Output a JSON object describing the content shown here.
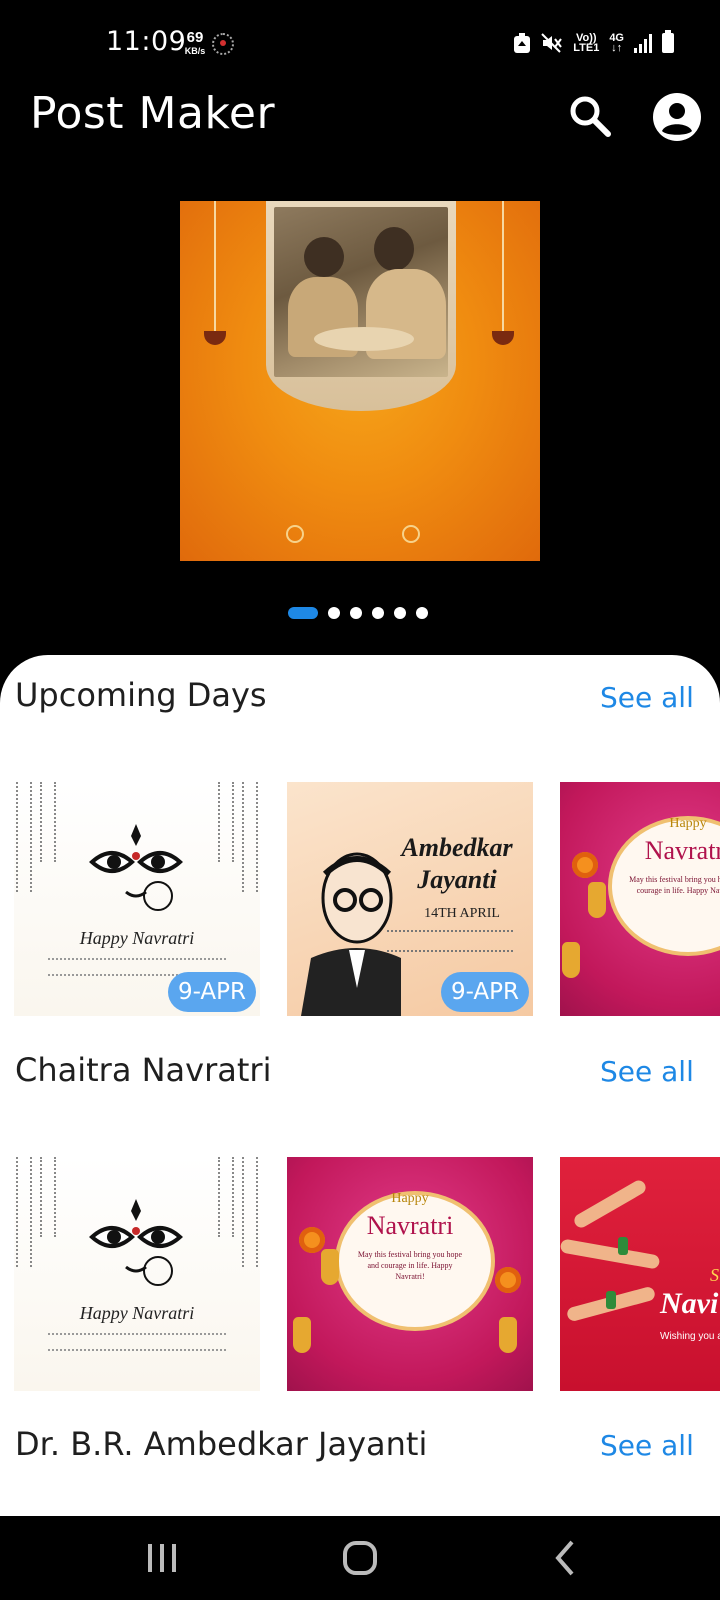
{
  "status_bar": {
    "time": "11:09",
    "speed_value": "69",
    "speed_unit": "KB/s",
    "network_label_top": "Vo))",
    "network_label_bottom": "LTE1",
    "network_type": "4G"
  },
  "app_bar": {
    "title": "Post Maker",
    "search_icon": "search-icon",
    "profile_icon": "account-circle-icon"
  },
  "carousel": {
    "page_count": 6,
    "active_index": 0
  },
  "sections": [
    {
      "title": "Upcoming Days",
      "see_all": "See all",
      "cards": [
        {
          "caption": "Happy Navratri",
          "badge": "9-APR"
        },
        {
          "title_line1": "Ambedkar",
          "title_line2": "Jayanti",
          "date": "14TH APRIL",
          "badge": "9-APR"
        },
        {
          "happy": "Happy",
          "title": "Navratri",
          "sub": "May this festival bring you hope and courage in life. Happy Navratri!"
        }
      ]
    },
    {
      "title": "Chaitra Navratri",
      "see_all": "See all",
      "cards": [
        {
          "caption": "Happy Navratri"
        },
        {
          "happy": "Happy",
          "title": "Navratri",
          "sub": "May this festival bring you hope and courage in life. Happy Navratri!"
        },
        {
          "title_small": "Su",
          "title": "Navi",
          "sub": "Wishing you a N faith, love, and l"
        }
      ]
    },
    {
      "title": "Dr. B.R. Ambedkar Jayanti",
      "see_all": "See all"
    }
  ],
  "nav_bar": {
    "recent_icon": "recent-apps-icon",
    "home_icon": "home-icon",
    "back_icon": "back-icon"
  },
  "colors": {
    "accent": "#1e88e5",
    "badge": "#5aa6ef",
    "background": "#000000",
    "sheet": "#ffffff"
  }
}
